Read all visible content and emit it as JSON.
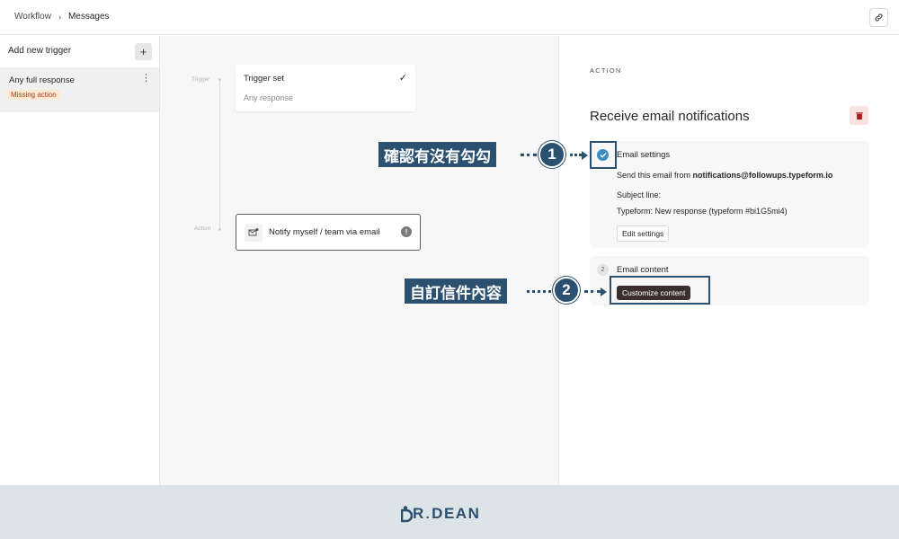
{
  "header": {
    "breadcrumb": [
      "Workflow",
      "Messages"
    ],
    "separator": "›",
    "link_icon": "link-icon"
  },
  "sidebar": {
    "title": "Add new trigger",
    "add_label": "+",
    "items": [
      {
        "label": "Any full response",
        "badge": "Missing action",
        "menu": "⋮"
      }
    ]
  },
  "canvas": {
    "trigger_label": "Trigger",
    "action_label": "Action",
    "trigger_card": {
      "title": "Trigger set",
      "subtitle": "Any response",
      "check": "✓"
    },
    "action_card": {
      "label": "Notify myself / team via email",
      "warning": "!"
    }
  },
  "panel": {
    "kicker": "ACTION",
    "title": "Receive email notifications",
    "email_settings": {
      "title": "Email settings",
      "sender_prefix": "Send this email from ",
      "sender": "notifications@followups.typeform.io",
      "subject_label": "Subject line:",
      "subject_value": "Typeform: New response (typeform #bi1G5mi4)",
      "edit_button": "Edit settings"
    },
    "email_content": {
      "step": "2",
      "title": "Email content",
      "button": "Customize content"
    }
  },
  "annotations": [
    {
      "number": "1",
      "text": "確認有沒有勾勾"
    },
    {
      "number": "2",
      "text": "自訂信件內容"
    }
  ],
  "footer": {
    "brand_left": "R",
    "brand_dot": ".",
    "brand_right": "DEAN"
  },
  "colors": {
    "annotation": "#2c5070",
    "check": "#3d8cc4",
    "badge_bg": "#fde9d2",
    "badge_text": "#b23b1c"
  }
}
